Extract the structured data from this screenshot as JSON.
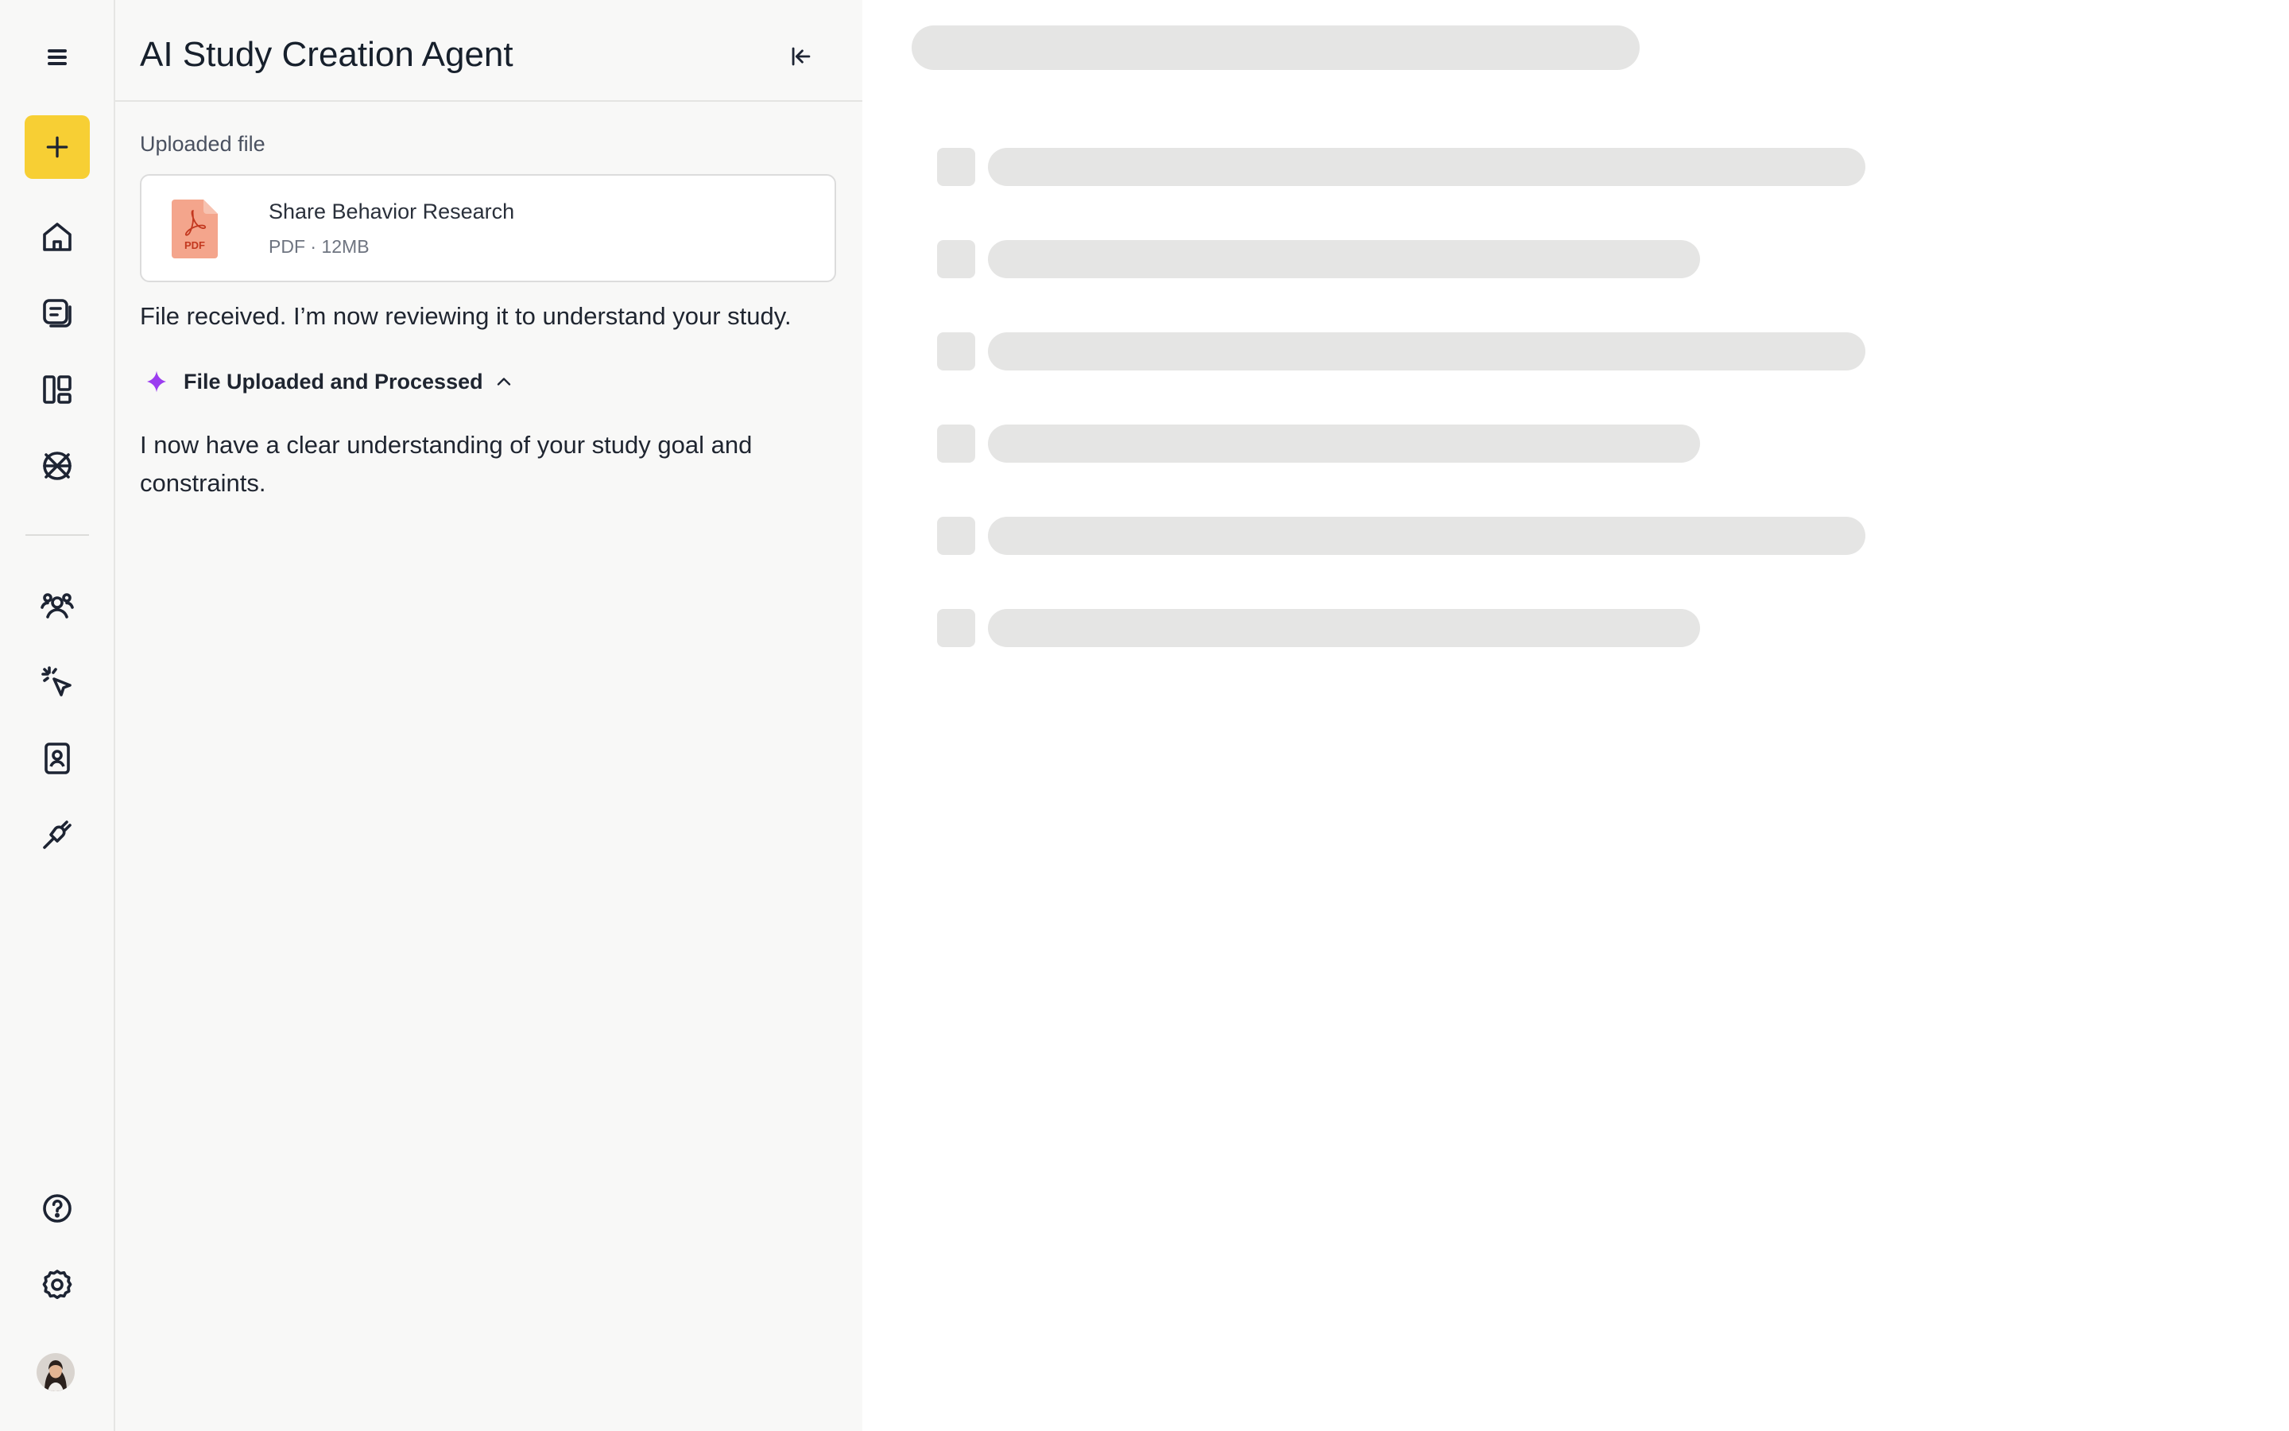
{
  "app": {
    "title": "AI Study Creation Agent"
  },
  "rail": {
    "top_icons": [
      "menu-icon",
      "plus-icon",
      "home-icon",
      "chat-icon",
      "layout-icon",
      "globe-icon"
    ],
    "bottom_icons": [
      "people-icon",
      "cursor-click-icon",
      "contact-card-icon",
      "plug-icon",
      "help-icon",
      "gear-icon",
      "avatar"
    ],
    "accent_color": "#f7cf34"
  },
  "panel": {
    "uploaded_label": "Uploaded file",
    "file": {
      "name": "Share Behavior Research",
      "type": "PDF",
      "separator": "·",
      "size": "12MB",
      "icon": "pdf-icon"
    },
    "message1": "File received. I’m now reviewing it to understand your study.",
    "status": {
      "label": "File Uploaded and Processed",
      "icon": "sparkle-icon",
      "icon_color": "#9b3df0",
      "expanded": true
    },
    "message2": "I now have a clear understanding of your study goal and constraints."
  },
  "main": {
    "state": "loading-skeleton",
    "skeleton_rows": 6
  }
}
